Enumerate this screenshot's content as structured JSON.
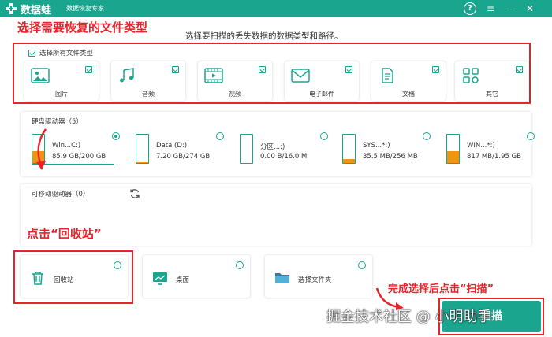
{
  "titlebar": {
    "app_name": "数据蛙",
    "subtitle": "数据恢复专家",
    "help_icon": "?",
    "menu_icon": "≡",
    "minimize_icon": "—",
    "close_icon": "✕"
  },
  "annotations": {
    "step1": "选择需要恢复的文件类型",
    "step2": "点击“回收站”",
    "step3": "完成选择后点击“扫描”"
  },
  "hint": "选择要扫描的丢失数据的数据类型和路径。",
  "file_types": {
    "select_all_label": "选择所有文件类型",
    "select_all_checked": true,
    "items": [
      {
        "label": "图片",
        "icon": "image-icon",
        "checked": true
      },
      {
        "label": "音频",
        "icon": "music-icon",
        "checked": true
      },
      {
        "label": "视频",
        "icon": "video-icon",
        "checked": true
      },
      {
        "label": "电子邮件",
        "icon": "email-icon",
        "checked": true
      },
      {
        "label": "文档",
        "icon": "document-icon",
        "checked": true
      },
      {
        "label": "其它",
        "icon": "other-icon",
        "checked": true
      }
    ]
  },
  "hard_drives": {
    "title": "硬盘驱动器（5）",
    "items": [
      {
        "name": "Win...C:)",
        "size": "85.9 GB/200 GB",
        "selected": true,
        "usage": 0.43
      },
      {
        "name": "Data (D:)",
        "size": "7.20 GB/274 GB",
        "selected": false,
        "usage": 0.03
      },
      {
        "name": "分区...:)",
        "size": "0.00  B/16.0 M",
        "selected": false,
        "usage": 0.0
      },
      {
        "name": "SYS...*:)",
        "size": "35.5 MB/256 MB",
        "selected": false,
        "usage": 0.14
      },
      {
        "name": "WIN...*:)",
        "size": "817 MB/1.95 GB",
        "selected": false,
        "usage": 0.42
      }
    ]
  },
  "removable_drives": {
    "title": "可移动驱动器（0）"
  },
  "locations": [
    {
      "label": "回收站",
      "icon": "trash-icon",
      "selected": false
    },
    {
      "label": "桌面",
      "icon": "desktop-icon",
      "selected": false
    },
    {
      "label": "选择文件夹",
      "icon": "folder-icon",
      "selected": false
    }
  ],
  "scan_button": "扫描",
  "watermark": "掘金技术社区 @ 小明助手",
  "colors": {
    "accent": "#1aa58f",
    "annotation": "#e8232a",
    "disk_fill": "#f29410"
  }
}
